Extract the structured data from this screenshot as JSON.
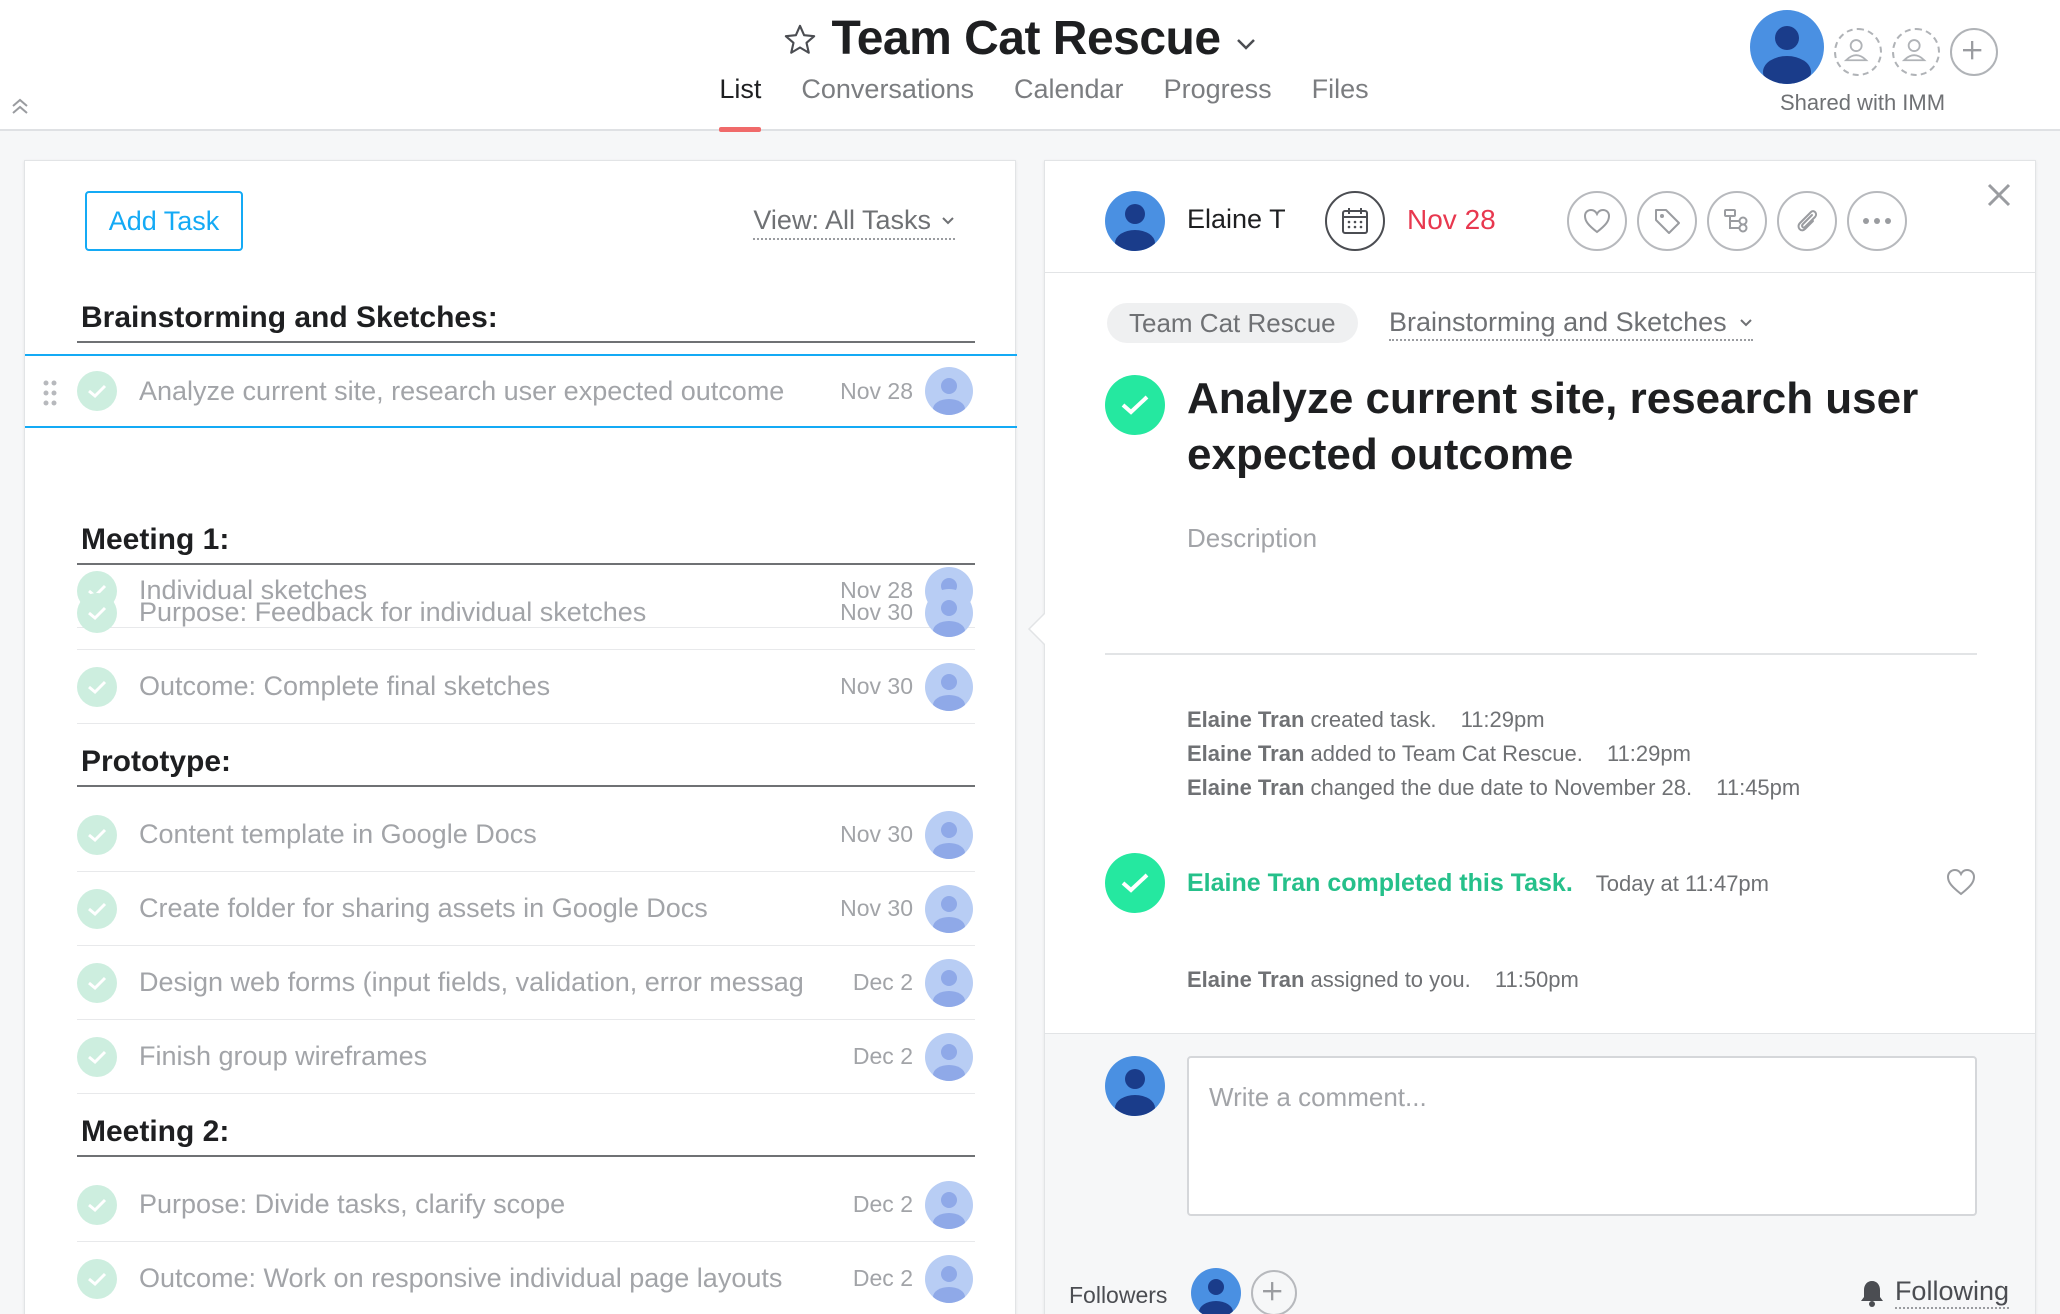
{
  "header": {
    "project_title": "Team Cat Rescue",
    "tabs": [
      "List",
      "Conversations",
      "Calendar",
      "Progress",
      "Files"
    ],
    "active_tab": "List",
    "shared_label": "Shared with IMM"
  },
  "list": {
    "add_task_label": "Add Task",
    "view_label": "View: All Tasks",
    "sections": [
      {
        "name": "Brainstorming and Sketches:",
        "tasks": [
          {
            "title": "Analyze current site, research user expected outcome",
            "due": "Nov 28",
            "selected": true
          },
          {
            "title": "Individual sketches",
            "due": "Nov 28"
          }
        ]
      },
      {
        "name": "Meeting 1:",
        "tasks": [
          {
            "title": "Purpose: Feedback for individual sketches",
            "due": "Nov 30"
          },
          {
            "title": "Outcome: Complete final sketches",
            "due": "Nov 30"
          }
        ]
      },
      {
        "name": "Prototype:",
        "tasks": [
          {
            "title": "Content template in Google Docs",
            "due": "Nov 30"
          },
          {
            "title": "Create folder for sharing assets in Google Docs",
            "due": "Nov 30"
          },
          {
            "title": "Design web forms (input fields, validation, error messag",
            "due": "Dec 2"
          },
          {
            "title": "Finish group wireframes",
            "due": "Dec 2"
          }
        ]
      },
      {
        "name": "Meeting 2:",
        "tasks": [
          {
            "title": "Purpose: Divide tasks, clarify scope",
            "due": "Dec 2"
          },
          {
            "title": "Outcome: Work on responsive individual page layouts",
            "due": "Dec 2"
          }
        ]
      }
    ]
  },
  "detail": {
    "assignee": "Elaine T",
    "due": "Nov 28",
    "project_pill": "Team Cat Rescue",
    "section": "Brainstorming and Sketches",
    "title": "Analyze current site, research user expected outcome",
    "description_placeholder": "Description",
    "activity": [
      {
        "actor": "Elaine Tran",
        "text": "created task.",
        "time": "11:29pm"
      },
      {
        "actor": "Elaine Tran",
        "text": "added to Team Cat Rescue.",
        "time": "11:29pm"
      },
      {
        "actor": "Elaine Tran",
        "text": "changed the due date to November 28.",
        "time": "11:45pm"
      }
    ],
    "completed_text": "Elaine Tran completed this Task.",
    "completed_time": "Today at 11:47pm",
    "assigned": {
      "actor": "Elaine Tran",
      "text": "assigned to you.",
      "time": "11:50pm"
    },
    "comment_placeholder": "Write a comment...",
    "followers_label": "Followers",
    "following_label": "Following"
  },
  "colors": {
    "accent_blue": "#14aaf5",
    "complete_green": "#25e8a0",
    "due_red": "#e8384f",
    "tab_underline": "#f06a6a"
  },
  "icons": [
    "star-icon",
    "chevron-down-icon",
    "collapse-up-icon",
    "person-icon",
    "plus-icon",
    "calendar-icon",
    "heart-icon",
    "tag-icon",
    "subtask-icon",
    "paperclip-icon",
    "more-icon",
    "close-icon",
    "check-icon",
    "bell-icon",
    "drag-handle-icon"
  ]
}
